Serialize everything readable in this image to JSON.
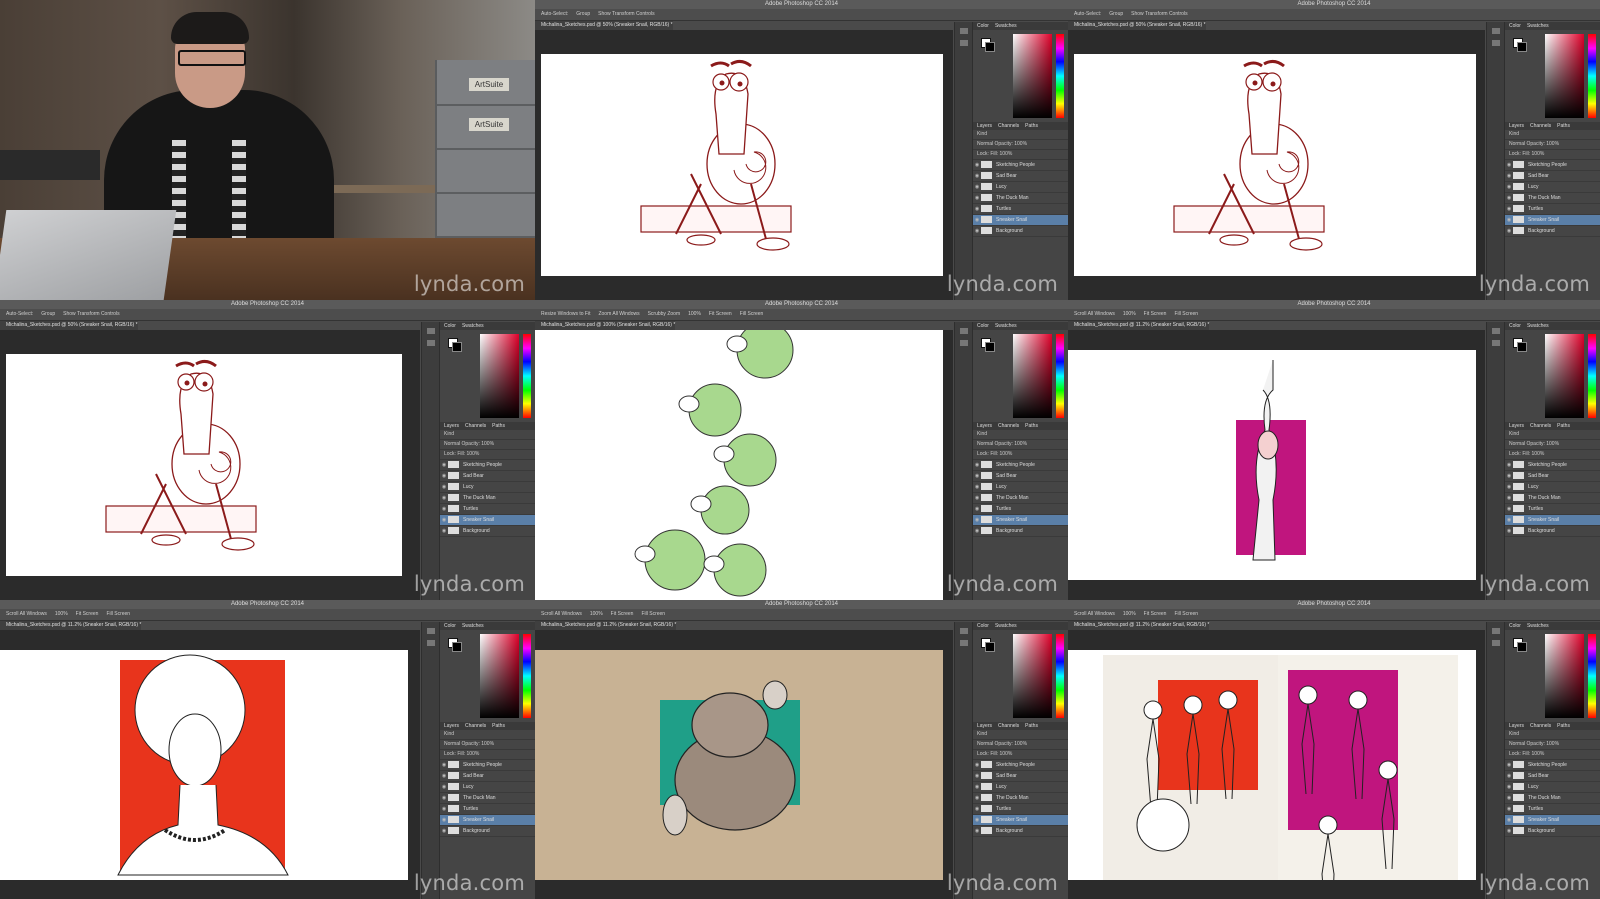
{
  "watermark": "lynda.com",
  "app": {
    "title": "Adobe Photoshop CC 2014",
    "options_move": [
      "Auto-Select:",
      "Group",
      "Show Transform Controls"
    ],
    "options_zoom": [
      "Resize Windows to Fit",
      "Zoom All Windows",
      "Scrubby Zoom",
      "100%",
      "Fit Screen",
      "Fill Screen"
    ],
    "options_hand": [
      "Scroll All Windows",
      "100%",
      "Fit Screen",
      "Fill Screen"
    ],
    "doc_tab_a": "Michalina_Sketches.psd @ 50% (Sneaker Snail, RGB/16) *",
    "doc_tab_b": "Michalina_Sketches.psd @ 100% (Sneaker Snail, RGB/16) *",
    "doc_tab_c": "Michalina_Sketches.psd @ 11.2% (Sneaker Snail, RGB/16) *",
    "panel_tabs_top": [
      "Color",
      "Swatches"
    ],
    "panel_tabs_layers": [
      "Layers",
      "Channels",
      "Paths"
    ],
    "layer_controls": [
      "Kind",
      "Normal",
      "Opacity: 100%",
      "Lock:",
      "Fill: 100%"
    ],
    "layers": [
      "Sketching People",
      "Sad Bear",
      "Lucy",
      "The Duck Man",
      "Turtles",
      "Sneaker Snail",
      "Background"
    ],
    "selected_layer": "Sneaker Snail"
  },
  "video": {
    "drawer_labels": [
      "ArtSuite",
      "ArtSuite"
    ]
  },
  "colors": {
    "snail_line": "#8b1a1a",
    "turtle_green": "#a8d88e",
    "magenta": "#c0157e",
    "red_bg": "#e8341c",
    "teal": "#1f9f88",
    "kraft": "#c8b294",
    "layer_selected": "#5a7fa8"
  }
}
